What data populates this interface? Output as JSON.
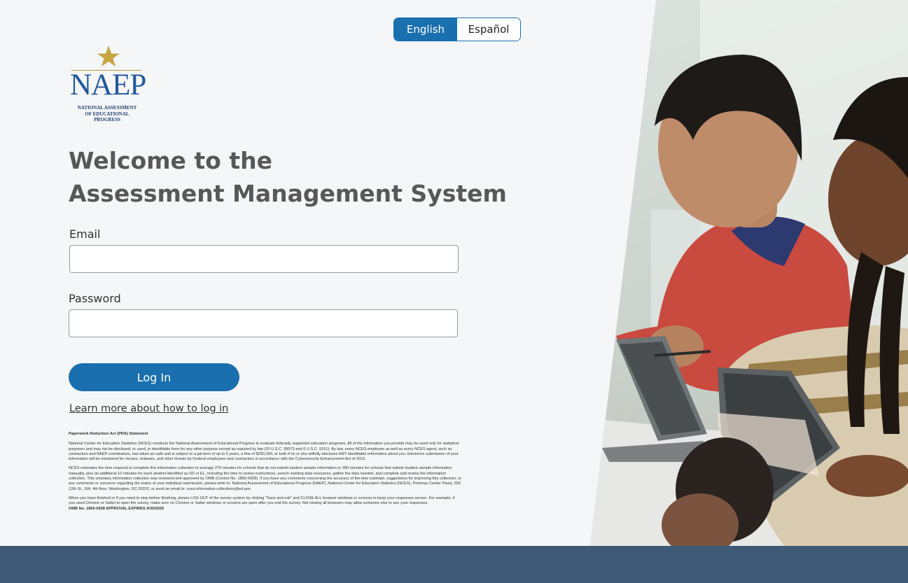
{
  "language_toggle": {
    "english": "English",
    "spanish": "Español",
    "selected": "English"
  },
  "logo": {
    "wordmark": "NAEP",
    "subtitle_lines": [
      "NATIONAL ASSESSMENT",
      "OF EDUCATIONAL",
      "PROGRESS"
    ]
  },
  "heading": {
    "line1": "Welcome to the",
    "line2": "Assessment Management System"
  },
  "form": {
    "email_label": "Email",
    "email_value": "",
    "password_label": "Password",
    "password_value": "",
    "login_button": "Log In",
    "learn_link": "Learn more about how to log in"
  },
  "pra": {
    "title": "Paperwork Reduction Act (PRA) Statement",
    "paragraph1": "National Center for Education Statistics (NCES) conducts the National Assessment of Educational Progress to evaluate federally supported education programs. All of the information you provide may be used only for statistical purposes and may not be disclosed, or used, in identifiable form for any other purpose except as required by law (20 U.S.C. §9573 and 6 U.S.C. §151). By law, every NCES employee as well as every NCES agent, such as contractors and NAEP coordinators, has taken an oath and is subject to a jail term of up to 5 years, a fine of $250,000, or both if he or she willfully discloses ANY identifiable information about you. Electronic submission of your information will be monitored for viruses, malware, and other threats by Federal employees and contractors in accordance with the Cybersecurity Enhancement Act of 2015.",
    "paragraph2": "NCES estimates the time required to complete this information collection to average 270 minutes for schools that do not submit student sample information or 390 minutes for schools that submit student sample information manually, plus an additional 10 minutes for each student identified as SD or EL, including the time to review instructions, search existing data resources, gather the data needed, and complete and review the information collection. This voluntary information collection was reviewed and approved by OMB (Control No. 1850-0928). If you have any comments concerning the accuracy of the time estimate, suggestions for improving this collection, or any comments or concerns regarding the status of your individual submission, please write to: National Assessment of Educational Progress (NAEP), National Center for Education Statistics (NCES), Potomac Center Plaza, 550 12th St., SW, 4th floor, Washington, DC 20202, or send an email to: nces.information.collections@ed.gov.",
    "paragraph3": "When you have finished or if you need to stop before finishing, please LOG OUT of the survey system by clicking \"Save and exit\" and CLOSE ALL browser windows or screens to keep your responses secure. For example, if you used Chrome or Safari to open the survey, make sure no Chrome or Safari windows or screens are open after you end the survey. Not closing all browsers may allow someone else to see your responses.",
    "omb": "OMB No. 1850-0928  APPROVAL EXPIRES 4/30/2026"
  }
}
